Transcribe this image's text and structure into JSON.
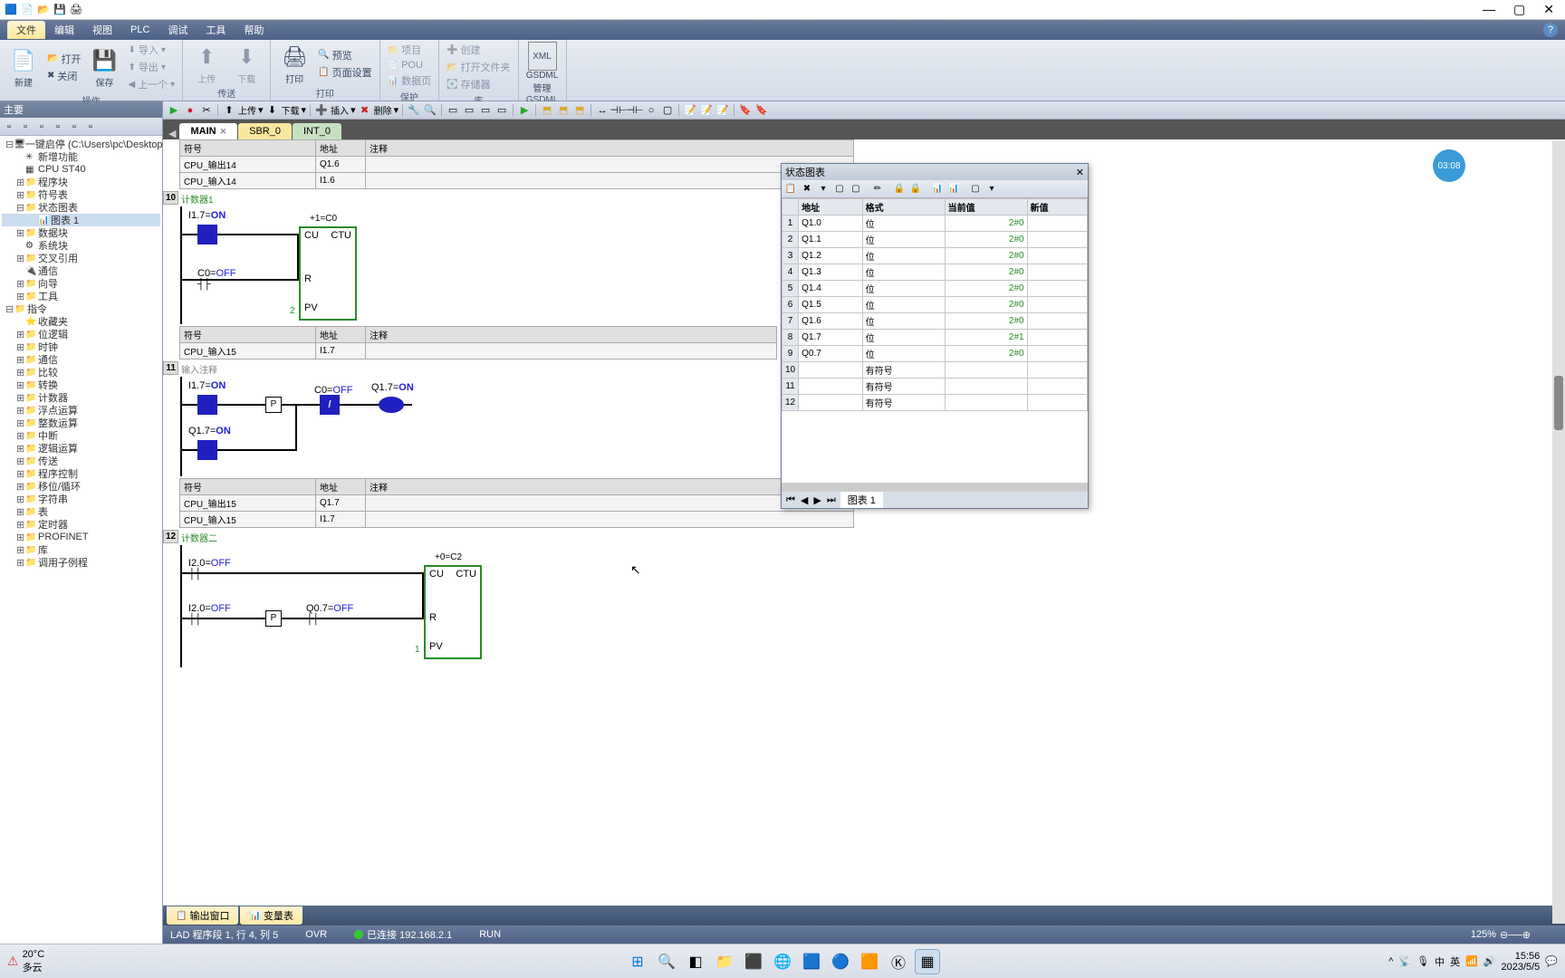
{
  "menus": {
    "file": "文件",
    "edit": "编辑",
    "view": "视图",
    "plc": "PLC",
    "debug": "调试",
    "tools": "工具",
    "help": "帮助"
  },
  "ribbon": {
    "new": "新建",
    "open": "打开",
    "close": "关闭",
    "save": "保存",
    "import": "导入",
    "export": "导出",
    "prev": "上一个",
    "upload": "上传",
    "download": "下载",
    "print": "打印",
    "preview": "预览",
    "pageSetup": "页面设置",
    "project": "项目",
    "pou": "POU",
    "dataPage": "数据页",
    "create": "创建",
    "openFolder": "打开文件夹",
    "storage": "存储器",
    "gsdml": "GSDML\n管理",
    "groups": {
      "op": "操作",
      "transfer": "传送",
      "print": "打印",
      "protect": "保护",
      "lib": "库",
      "gsdml": "GSDML"
    }
  },
  "left": {
    "title": "主要",
    "root": "一键启停 (C:\\Users\\pc\\Desktop)",
    "nodes": {
      "newFeat": "新增功能",
      "cpu": "CPU ST40",
      "progBlock": "程序块",
      "symTable": "符号表",
      "statusChart": "状态图表",
      "chart1": "图表 1",
      "dataBlock": "数据块",
      "sysBlock": "系统块",
      "xref": "交叉引用",
      "comm": "通信",
      "wizard": "向导",
      "tool": "工具",
      "instr": "指令",
      "fav": "收藏夹",
      "bitLogic": "位逻辑",
      "clock": "时钟",
      "commGrp": "通信",
      "compare": "比较",
      "convert": "转换",
      "counter": "计数器",
      "floatMath": "浮点运算",
      "intMath": "整数运算",
      "interrupt": "中断",
      "logicOp": "逻辑运算",
      "transfer": "传送",
      "progCtrl": "程序控制",
      "shiftRot": "移位/循环",
      "string": "字符串",
      "table": "表",
      "timer": "定时器",
      "profinet": "PROFINET",
      "library": "库",
      "callSub": "调用子例程"
    }
  },
  "tabs": {
    "main": "MAIN",
    "sbr": "SBR_0",
    "int": "INT_0"
  },
  "editorToolbar": {
    "upload": "上传",
    "download": "下载",
    "insert": "插入",
    "delete": "删除"
  },
  "symbolHeaders": {
    "symbol": "符号",
    "address": "地址",
    "comment": "注释"
  },
  "networks": {
    "n10": {
      "comment": "计数器1",
      "i17": "I1.7=",
      "i17v": "ON",
      "c0": "C0=",
      "c0v": "OFF",
      "ctuTitle": "+1=C0",
      "cu": "CU",
      "ctu": "CTU",
      "r": "R",
      "pv": "PV",
      "pvVal": "2"
    },
    "symRow1": {
      "sym": "CPU_输出14",
      "addr": "Q1.6"
    },
    "symRow2": {
      "sym": "CPU_输入14",
      "addr": "I1.6"
    },
    "symRowA": {
      "sym": "CPU_输入15",
      "addr": "I1.7"
    },
    "n11": {
      "comment": "输入注释",
      "i17a": "I1.7=",
      "i17av": "ON",
      "q17b": "Q1.7=",
      "q17bv": "ON",
      "c0": "C0=",
      "c0v": "OFF",
      "q17": "Q1.7=",
      "q17v": "ON",
      "p": "P",
      "slash": "/"
    },
    "symRowB1": {
      "sym": "CPU_输出15",
      "addr": "Q1.7"
    },
    "symRowB2": {
      "sym": "CPU_输入15",
      "addr": "I1.7"
    },
    "n12": {
      "comment": "计数器二",
      "i20a": "I2.0=",
      "i20av": "OFF",
      "i20b": "I2.0=",
      "i20bv": "OFF",
      "q07": "Q0.7=",
      "q07v": "OFF",
      "ctuTitle": "+0=C2",
      "cu": "CU",
      "ctu": "CTU",
      "r": "R",
      "pv": "PV",
      "pvVal": "1",
      "p": "P"
    }
  },
  "statusChart": {
    "title": "状态图表",
    "cols": {
      "addr": "地址",
      "fmt": "格式",
      "cur": "当前值",
      "new": "新值"
    },
    "tabLabel": "图表 1",
    "rows": [
      {
        "addr": "Q1.0",
        "fmt": "位",
        "cur": "2#0"
      },
      {
        "addr": "Q1.1",
        "fmt": "位",
        "cur": "2#0"
      },
      {
        "addr": "Q1.2",
        "fmt": "位",
        "cur": "2#0"
      },
      {
        "addr": "Q1.3",
        "fmt": "位",
        "cur": "2#0"
      },
      {
        "addr": "Q1.4",
        "fmt": "位",
        "cur": "2#0"
      },
      {
        "addr": "Q1.5",
        "fmt": "位",
        "cur": "2#0"
      },
      {
        "addr": "Q1.6",
        "fmt": "位",
        "cur": "2#0"
      },
      {
        "addr": "Q1.7",
        "fmt": "位",
        "cur": "2#1"
      },
      {
        "addr": "Q0.7",
        "fmt": "位",
        "cur": "2#0"
      },
      {
        "addr": "",
        "fmt": "有符号",
        "cur": ""
      },
      {
        "addr": "",
        "fmt": "有符号",
        "cur": ""
      },
      {
        "addr": "",
        "fmt": "有符号",
        "cur": ""
      }
    ]
  },
  "bottomTabs": {
    "output": "输出窗口",
    "varTable": "变量表"
  },
  "statusbar": {
    "lad": "LAD 程序段 1, 行 4, 列 5",
    "ovr": "OVR",
    "conn": "已连接 192.168.2.1",
    "run": "RUN",
    "zoom": "125%"
  },
  "timeBadge": "03:08",
  "taskbar": {
    "temp": "20°C",
    "weather": "多云",
    "time": "15:56",
    "date": "2023/5/5",
    "ime": "中",
    "imeSub": "英"
  }
}
